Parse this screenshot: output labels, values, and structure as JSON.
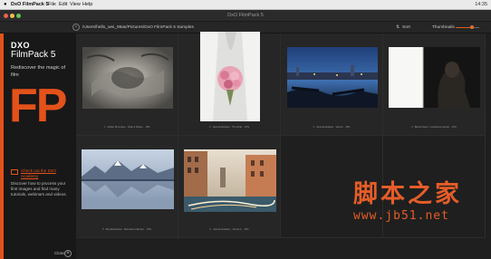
{
  "menubar": {
    "app_name": "DxO FilmPack 5",
    "items": [
      "File",
      "Edit",
      "View",
      "Help"
    ],
    "status": "14:35"
  },
  "window": {
    "title": "DxO FilmPack 5"
  },
  "toolbar": {
    "path": "/Users/hello_wei_08as/Pictures/DxO FilmPack 5 Samples",
    "sort_label": "Sort",
    "thumbnails_label": "Thumbnails",
    "thumbnail_size_level": 0.7
  },
  "sidebar": {
    "logo": "DXO",
    "product": "FilmPack 5",
    "tagline": "Rediscover the magic of film",
    "big_letters": "FP",
    "promo_link": "Check out the DxO Academy",
    "promo_desc": "Discover how to process your first images and find many tutorials, webinars and videos.",
    "close_label": "Close"
  },
  "thumbnails": [
    {
      "caption": "1 · Jordan Rimmaren · Dolls & Desire · .JPG"
    },
    {
      "caption": "2 · Jane Entertainer · The bride · .JPG"
    },
    {
      "caption": "3 · Jane Entertainer · Venice · .JPG"
    },
    {
      "caption": "4 · Barnet Sand · Loneliness portrait · .JPG"
    },
    {
      "caption": "5 · Ben Entertainer · Mountain reflection · .JPG"
    },
    {
      "caption": "6 · Jane Entertainer · Venice 2 · .JPG"
    }
  ],
  "watermark": {
    "chinese": "脚本之家",
    "url": "www.jb51.net"
  },
  "colors": {
    "accent": "#e3521a",
    "watermark": "#e55d28",
    "background": "#1f1f1f"
  }
}
